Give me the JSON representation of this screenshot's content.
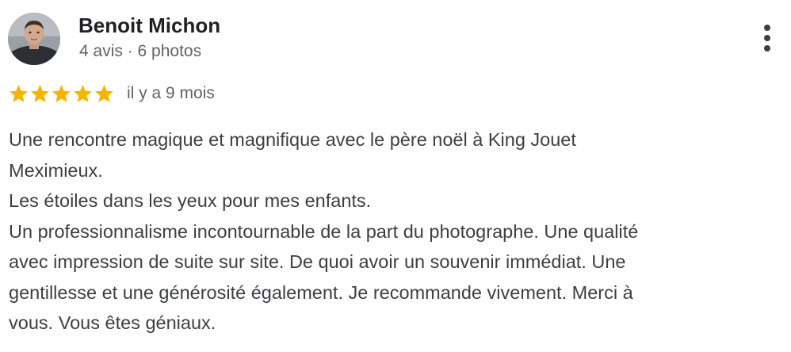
{
  "review": {
    "author": {
      "name": "Benoit Michon",
      "meta": "4 avis · 6 photos",
      "avatar_icon": "profile-photo"
    },
    "rating": {
      "stars": 5,
      "max_stars": 5,
      "star_color": "#F4B400",
      "date": "il y a 9 mois"
    },
    "menu_icon": "more-vert-icon",
    "text_lines": [
      "Une rencontre magique et magnifique avec le père noël à King Jouet",
      "Meximieux.",
      "Les étoiles dans les yeux pour mes enfants.",
      "Un professionnalisme incontournable de la part du photographe. Une qualité",
      "avec impression de suite sur site. De quoi avoir un souvenir immédiat. Une",
      "gentillesse et une générosité également. Je recommande vivement. Merci à",
      "vous. Vous êtes géniaux."
    ]
  }
}
